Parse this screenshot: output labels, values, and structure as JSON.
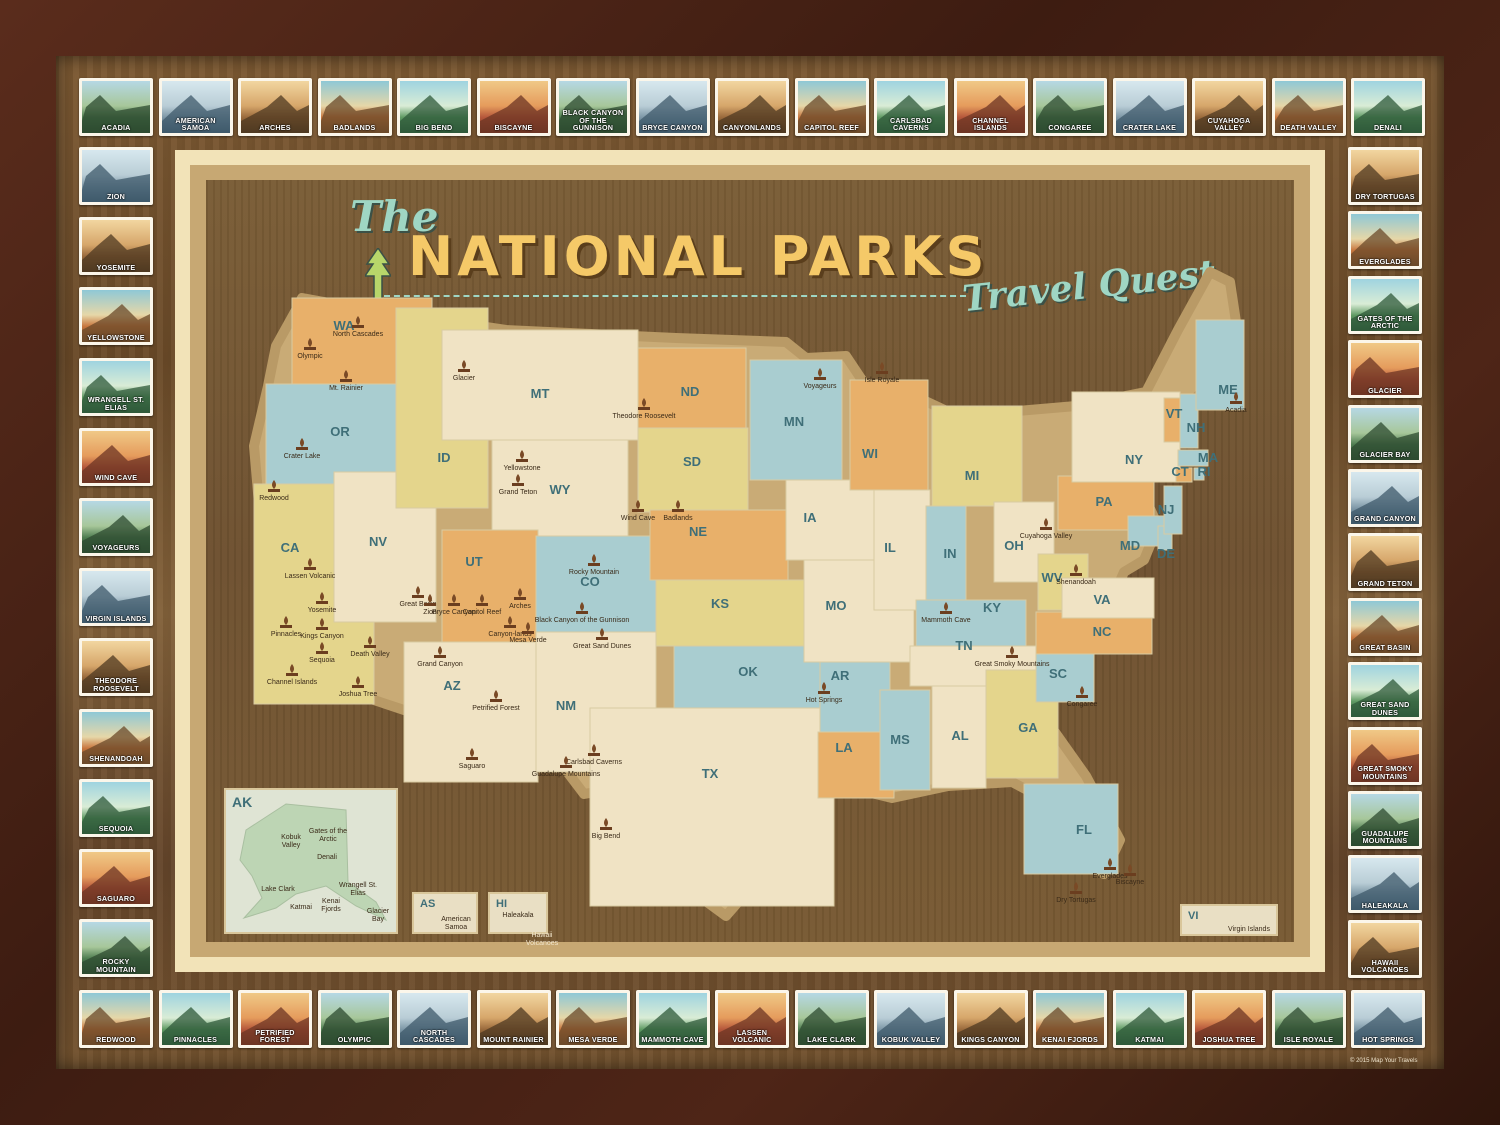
{
  "title": {
    "the": "The",
    "main": "NATIONAL PARKS",
    "sub": "Travel Quest"
  },
  "copyright": "© 2015 Map Your Travels",
  "stamps": {
    "top": [
      "ACADIA",
      "AMERICAN SAMOA",
      "ARCHES",
      "BADLANDS",
      "BIG BEND",
      "BISCAYNE",
      "BLACK CANYON OF THE GUNNISON",
      "BRYCE CANYON",
      "CANYONLANDS",
      "CAPITOL REEF",
      "CARLSBAD CAVERNS",
      "CHANNEL ISLANDS",
      "CONGAREE",
      "CRATER LAKE",
      "CUYAHOGA VALLEY",
      "DEATH VALLEY",
      "DENALI"
    ],
    "left": [
      "ZION",
      "YOSEMITE",
      "YELLOWSTONE",
      "WRANGELL ST. ELIAS",
      "WIND CAVE",
      "VOYAGEURS",
      "VIRGIN ISLANDS",
      "THEODORE ROOSEVELT",
      "SHENANDOAH",
      "SEQUOIA",
      "SAGUARO",
      "ROCKY MOUNTAIN"
    ],
    "right": [
      "DRY TORTUGAS",
      "EVERGLADES",
      "GATES OF THE ARCTIC",
      "GLACIER",
      "GLACIER BAY",
      "GRAND CANYON",
      "GRAND TETON",
      "GREAT BASIN",
      "GREAT SAND DUNES",
      "GREAT SMOKY MOUNTAINS",
      "GUADALUPE MOUNTAINS",
      "HALEAKALA",
      "HAWAII VOLCANOES"
    ],
    "bottom": [
      "REDWOOD",
      "PINNACLES",
      "PETRIFIED FOREST",
      "OLYMPIC",
      "NORTH CASCADES",
      "MOUNT RAINIER",
      "MESA VERDE",
      "MAMMOTH CAVE",
      "LASSEN VOLCANIC",
      "LAKE CLARK",
      "KOBUK VALLEY",
      "KINGS CANYON",
      "KENAI FJORDS",
      "KATMAI",
      "JOSHUA TREE",
      "ISLE ROYALE",
      "HOT SPRINGS"
    ]
  },
  "states": [
    "WA",
    "OR",
    "CA",
    "NV",
    "ID",
    "MT",
    "WY",
    "UT",
    "AZ",
    "CO",
    "NM",
    "ND",
    "SD",
    "NE",
    "KS",
    "OK",
    "TX",
    "MN",
    "IA",
    "MO",
    "AR",
    "LA",
    "WI",
    "IL",
    "MS",
    "MI",
    "IN",
    "KY",
    "TN",
    "AL",
    "OH",
    "GA",
    "FL",
    "SC",
    "NC",
    "WV",
    "VA",
    "PA",
    "NY",
    "MD",
    "DE",
    "NJ",
    "VT",
    "NH",
    "ME",
    "MA",
    "CT",
    "RI"
  ],
  "parks": [
    "Olympic",
    "North Cascades",
    "Mt. Rainier",
    "Glacier",
    "Crater Lake",
    "Redwood",
    "Lassen Volcanic",
    "Yosemite",
    "Pinnacles",
    "Kings Canyon",
    "Sequoia",
    "Death Valley",
    "Channel Islands",
    "Joshua Tree",
    "Great Basin",
    "Yellowstone",
    "Grand Teton",
    "Theodore Roosevelt",
    "Wind Cave",
    "Badlands",
    "Zion",
    "Bryce Canyon",
    "Capitol Reef",
    "Arches",
    "Canyon-lands",
    "Grand Canyon",
    "Petrified Forest",
    "Saguaro",
    "Rocky Mountain",
    "Black Canyon of the Gunnison",
    "Mesa Verde",
    "Great Sand Dunes",
    "Carlsbad Caverns",
    "Guadalupe Mountains",
    "Big Bend",
    "Voyageurs",
    "Isle Royale",
    "Hot Springs",
    "Mammoth Cave",
    "Great Smoky Mountains",
    "Cuyahoga Valley",
    "Shenandoah",
    "Congaree",
    "Acadia",
    "Everglades",
    "Biscayne",
    "Dry Tortugas"
  ],
  "insets": {
    "ak": {
      "abbr": "AK",
      "parks": [
        "Kobuk Valley",
        "Gates of the Arctic",
        "Denali",
        "Lake Clark",
        "Wrangell St. Elias",
        "Katmai",
        "Kenai Fjords",
        "Glacier Bay"
      ]
    },
    "as": {
      "abbr": "AS",
      "park": "American Samoa"
    },
    "hi": {
      "abbr": "HI",
      "parks": [
        "Haleakala",
        "Hawaii Volcanoes"
      ]
    },
    "vi": {
      "abbr": "VI",
      "park": "Virgin Islands"
    }
  },
  "colors": {
    "frame": "#4e2517",
    "wood": "#6e5130",
    "title_gold": "#f5c968",
    "title_teal": "#9fd6c4",
    "state_teal": "#a9cdd0",
    "state_yellow": "#e4d58c",
    "state_orange": "#e8b06a",
    "state_cream": "#f0e3c4",
    "label_teal": "#3f6f78"
  }
}
